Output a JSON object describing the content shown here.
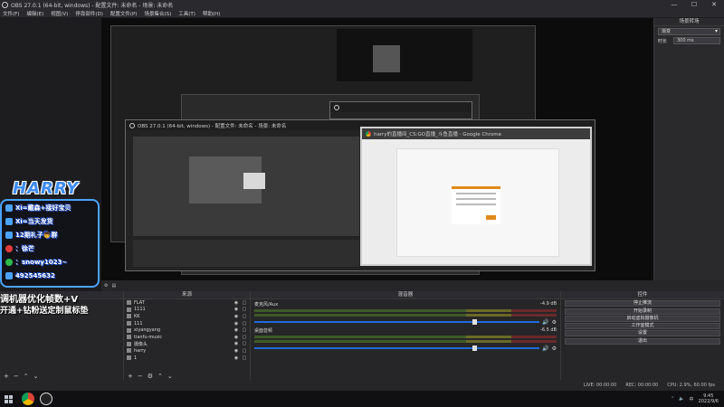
{
  "window": {
    "title": "OBS 27.0.1 (64-bit, windows) - 配置文件: 未命名 - 场景: 未命名",
    "controls": [
      "—",
      "☐",
      "✕"
    ]
  },
  "menu": [
    "文件(F)",
    "编辑(E)",
    "视图(V)",
    "停靠部件(D)",
    "配置文件(P)",
    "场景集合(S)",
    "工具(T)",
    "帮助(H)"
  ],
  "preview": {
    "inner_obs_title": "OBS 27.0.1 (64-bit, windows) - 配置文件: 未命名 - 场景: 未命名",
    "chrome_title": "harry的直播间_CS:GO直播_斗鱼直播 - Google Chrome"
  },
  "right_panel": {
    "header": "场景转场",
    "transition": "渐变",
    "duration_label": "时长",
    "duration_value": "300 ms"
  },
  "overlay": {
    "name": "HARRY",
    "lines": [
      {
        "icon": "qq-icon",
        "text": "Xi=戴森+接好宝贝"
      },
      {
        "icon": "qq-icon",
        "text": "Xi=当天发货"
      },
      {
        "icon": "qq-icon",
        "text": "12期礼子👦群"
      },
      {
        "icon": "weibo-icon",
        "text": "：徐芒"
      },
      {
        "icon": "wechat-icon",
        "text": "：snowy1023~"
      },
      {
        "icon": "qq-icon",
        "text": "492545632"
      }
    ],
    "promo1": "调机器优化帧数+V",
    "promo2": "开通+钻粉送定制鼠标垫"
  },
  "docks": {
    "scenes_label": "",
    "sources_label": "来源",
    "mixer_label": "混音器",
    "controls_label": "控件",
    "sources": [
      {
        "name": "FLAT"
      },
      {
        "name": "1111"
      },
      {
        "name": "KK"
      },
      {
        "name": "111"
      },
      {
        "name": "xiyangyang"
      },
      {
        "name": "tianfu-music"
      },
      {
        "name": "摄像头"
      },
      {
        "name": "harry"
      },
      {
        "name": "1"
      }
    ],
    "mixer": [
      {
        "name": "麦克风/Aux",
        "db": "-4.9 dB"
      },
      {
        "name": "桌面音频",
        "db": "-6.5 dB"
      }
    ],
    "controls": [
      "停止推流",
      "开始录制",
      "启动虚拟摄像机",
      "工作室模式",
      "设置",
      "退出"
    ]
  },
  "status": {
    "live": "LIVE: 00:00:00",
    "rec": "REC: 00:00:00",
    "cpu": "CPU: 2.9%, 60.00 fps"
  },
  "taskbar": {
    "time": "9:45",
    "date": "2022/9/6",
    "lang": "中"
  }
}
